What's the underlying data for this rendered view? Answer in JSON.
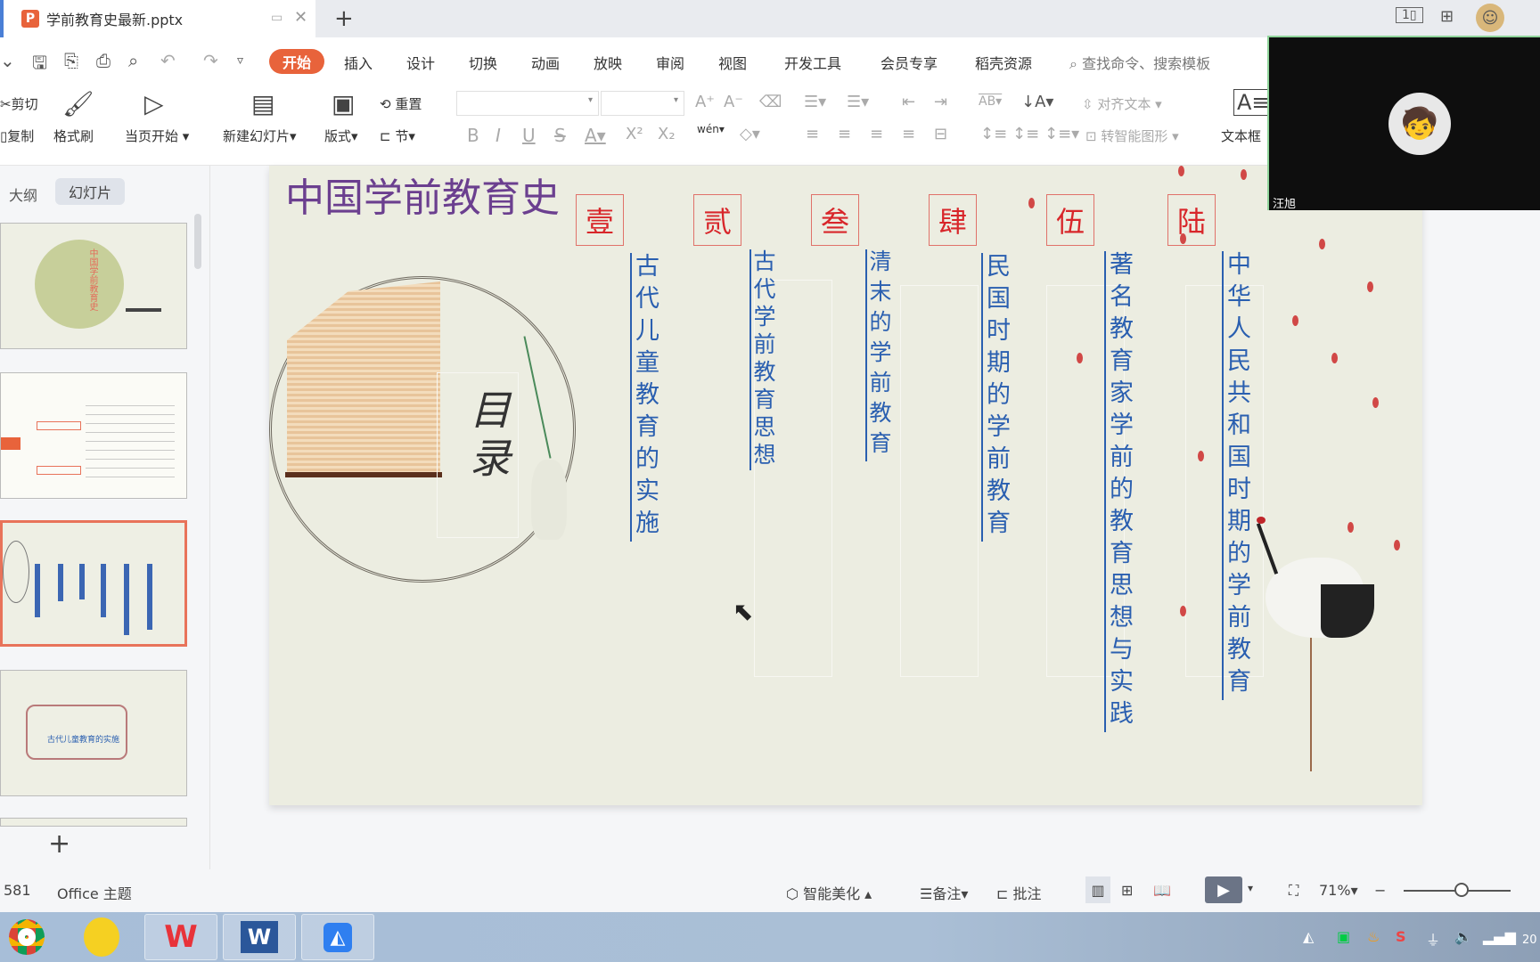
{
  "titlebar": {
    "document_name": "学前教育史最新.pptx",
    "app_logo": "P",
    "icons": [
      "pin-icon",
      "close-icon",
      "new-tab-icon",
      "single-view-icon",
      "grid-icon",
      "user-avatar"
    ]
  },
  "quick_access": {
    "icons": [
      "menu-icon",
      "save-icon",
      "export-pdf-icon",
      "print-icon",
      "print-preview-icon",
      "undo-icon",
      "redo-icon",
      "customize-icon"
    ]
  },
  "menu": {
    "tabs": [
      "开始",
      "插入",
      "设计",
      "切换",
      "动画",
      "放映",
      "审阅",
      "视图",
      "开发工具",
      "会员专享",
      "稻壳资源"
    ],
    "active": "开始",
    "search_placeholder": "查找命令、搜索模板"
  },
  "ribbon": {
    "cut": "剪切",
    "copy": "复制",
    "format_painter": "格式刷",
    "play_from_current": "当页开始",
    "new_slide": "新建幻灯片",
    "layout": "版式",
    "reset": "重置",
    "section": "节",
    "font_name": "",
    "font_size": "",
    "align_text": "对齐文本",
    "smartart": "转智能图形",
    "textbox": "文本框",
    "pinyin": "wén"
  },
  "left_panel": {
    "tabs": [
      "大纲",
      "幻灯片"
    ],
    "active_tab": "幻灯片",
    "add_slide": "+"
  },
  "slide": {
    "title": "中国学前教育史",
    "calligraphy": "目录",
    "sections": [
      {
        "number": "壹",
        "text": "古代儿童教育的实施"
      },
      {
        "number": "贰",
        "text": "古代学前教育思想"
      },
      {
        "number": "叁",
        "text": "清末的学前教育"
      },
      {
        "number": "肆",
        "text": "民国时期的学前教育"
      },
      {
        "number": "伍",
        "text": "著名教育家学前的教育思想与实践"
      },
      {
        "number": "陆",
        "text": "中华人民共和国时期的学前教育"
      }
    ],
    "colors": {
      "title": "#6b3f8f",
      "number": "#d8262a",
      "section_text": "#2a5fb0",
      "background": "#ecede1"
    }
  },
  "video": {
    "participant_name": "汪旭"
  },
  "statusbar": {
    "slide_info": "581",
    "theme": "Office 主题",
    "beautify": "智能美化",
    "notes": "备注",
    "comments": "批注",
    "zoom": "71%",
    "zoom_minus": "−",
    "zoom_level": 0.71
  },
  "taskbar": {
    "apps": [
      "Chrome",
      "Music",
      "WPS Office",
      "Word",
      "Feishu"
    ],
    "clock_partial": "20"
  }
}
